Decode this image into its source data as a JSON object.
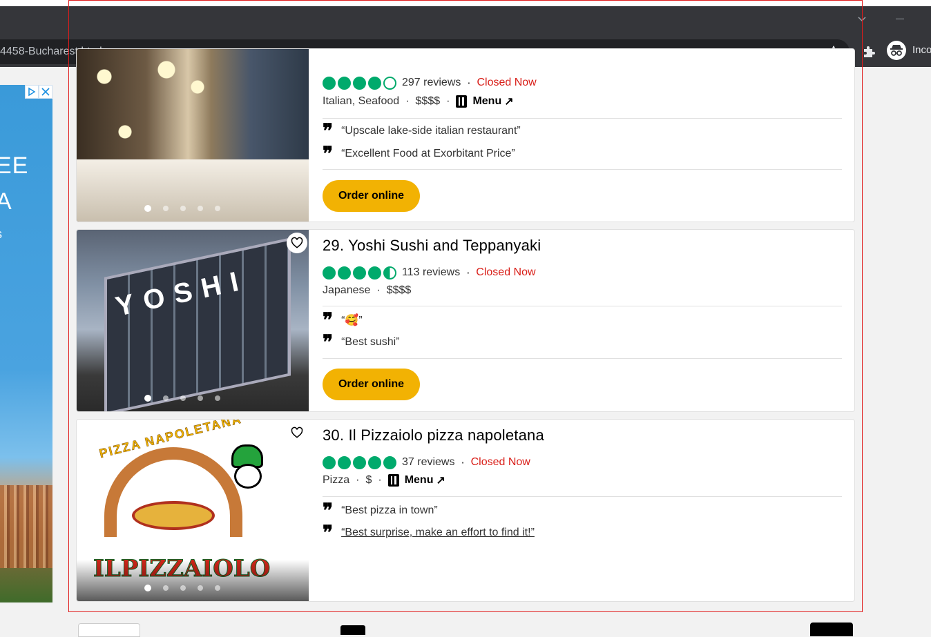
{
  "browser": {
    "url_fragment": "4458-Bucharest.html",
    "incognito_label": "Inco"
  },
  "restaurants": [
    {
      "name": "",
      "reviews": "297 reviews",
      "status": "Closed Now",
      "rating": 4,
      "cuisine": "Italian, Seafood",
      "price": "$$$$",
      "menu_label": "Menu",
      "quotes": [
        "“Upscale lake-side italian restaurant”",
        "“Excellent Food at Exorbitant Price”"
      ],
      "order_label": "Order online"
    },
    {
      "name": "29. Yoshi Sushi and Teppanyaki",
      "reviews": "113 reviews",
      "status": "Closed Now",
      "rating": 4.5,
      "cuisine": "Japanese",
      "price": "$$$$",
      "quotes": [
        "“🥰”",
        "“Best sushi”"
      ],
      "order_label": "Order online",
      "photo_sign": "YOSHI"
    },
    {
      "name": "30. Il Pizzaiolo pizza napoletana",
      "reviews": "37 reviews",
      "status": "Closed Now",
      "rating": 5,
      "cuisine": "Pizza",
      "price": "$",
      "menu_label": "Menu",
      "quotes": [
        "“Best pizza in town”",
        "“Best surprise, make an effort to find it!”"
      ],
      "logo_top": "PIZZA NAPOLETANA",
      "logo_main": "ILPIZZAIOLO"
    }
  ],
  "ad": {
    "line1": "EE",
    "line2": "A",
    "line3": "s"
  },
  "icons": {
    "star": "star-icon",
    "extensions": "puzzle-icon",
    "incognito": "incognito-icon",
    "heart": "heart-icon",
    "quote": "quote-icon",
    "menu": "menu-icon"
  },
  "colors": {
    "rating_green": "#00aa6c",
    "closed_red": "#d91e18",
    "order_yellow": "#f2b203",
    "highlight_red": "#e01b1b"
  }
}
